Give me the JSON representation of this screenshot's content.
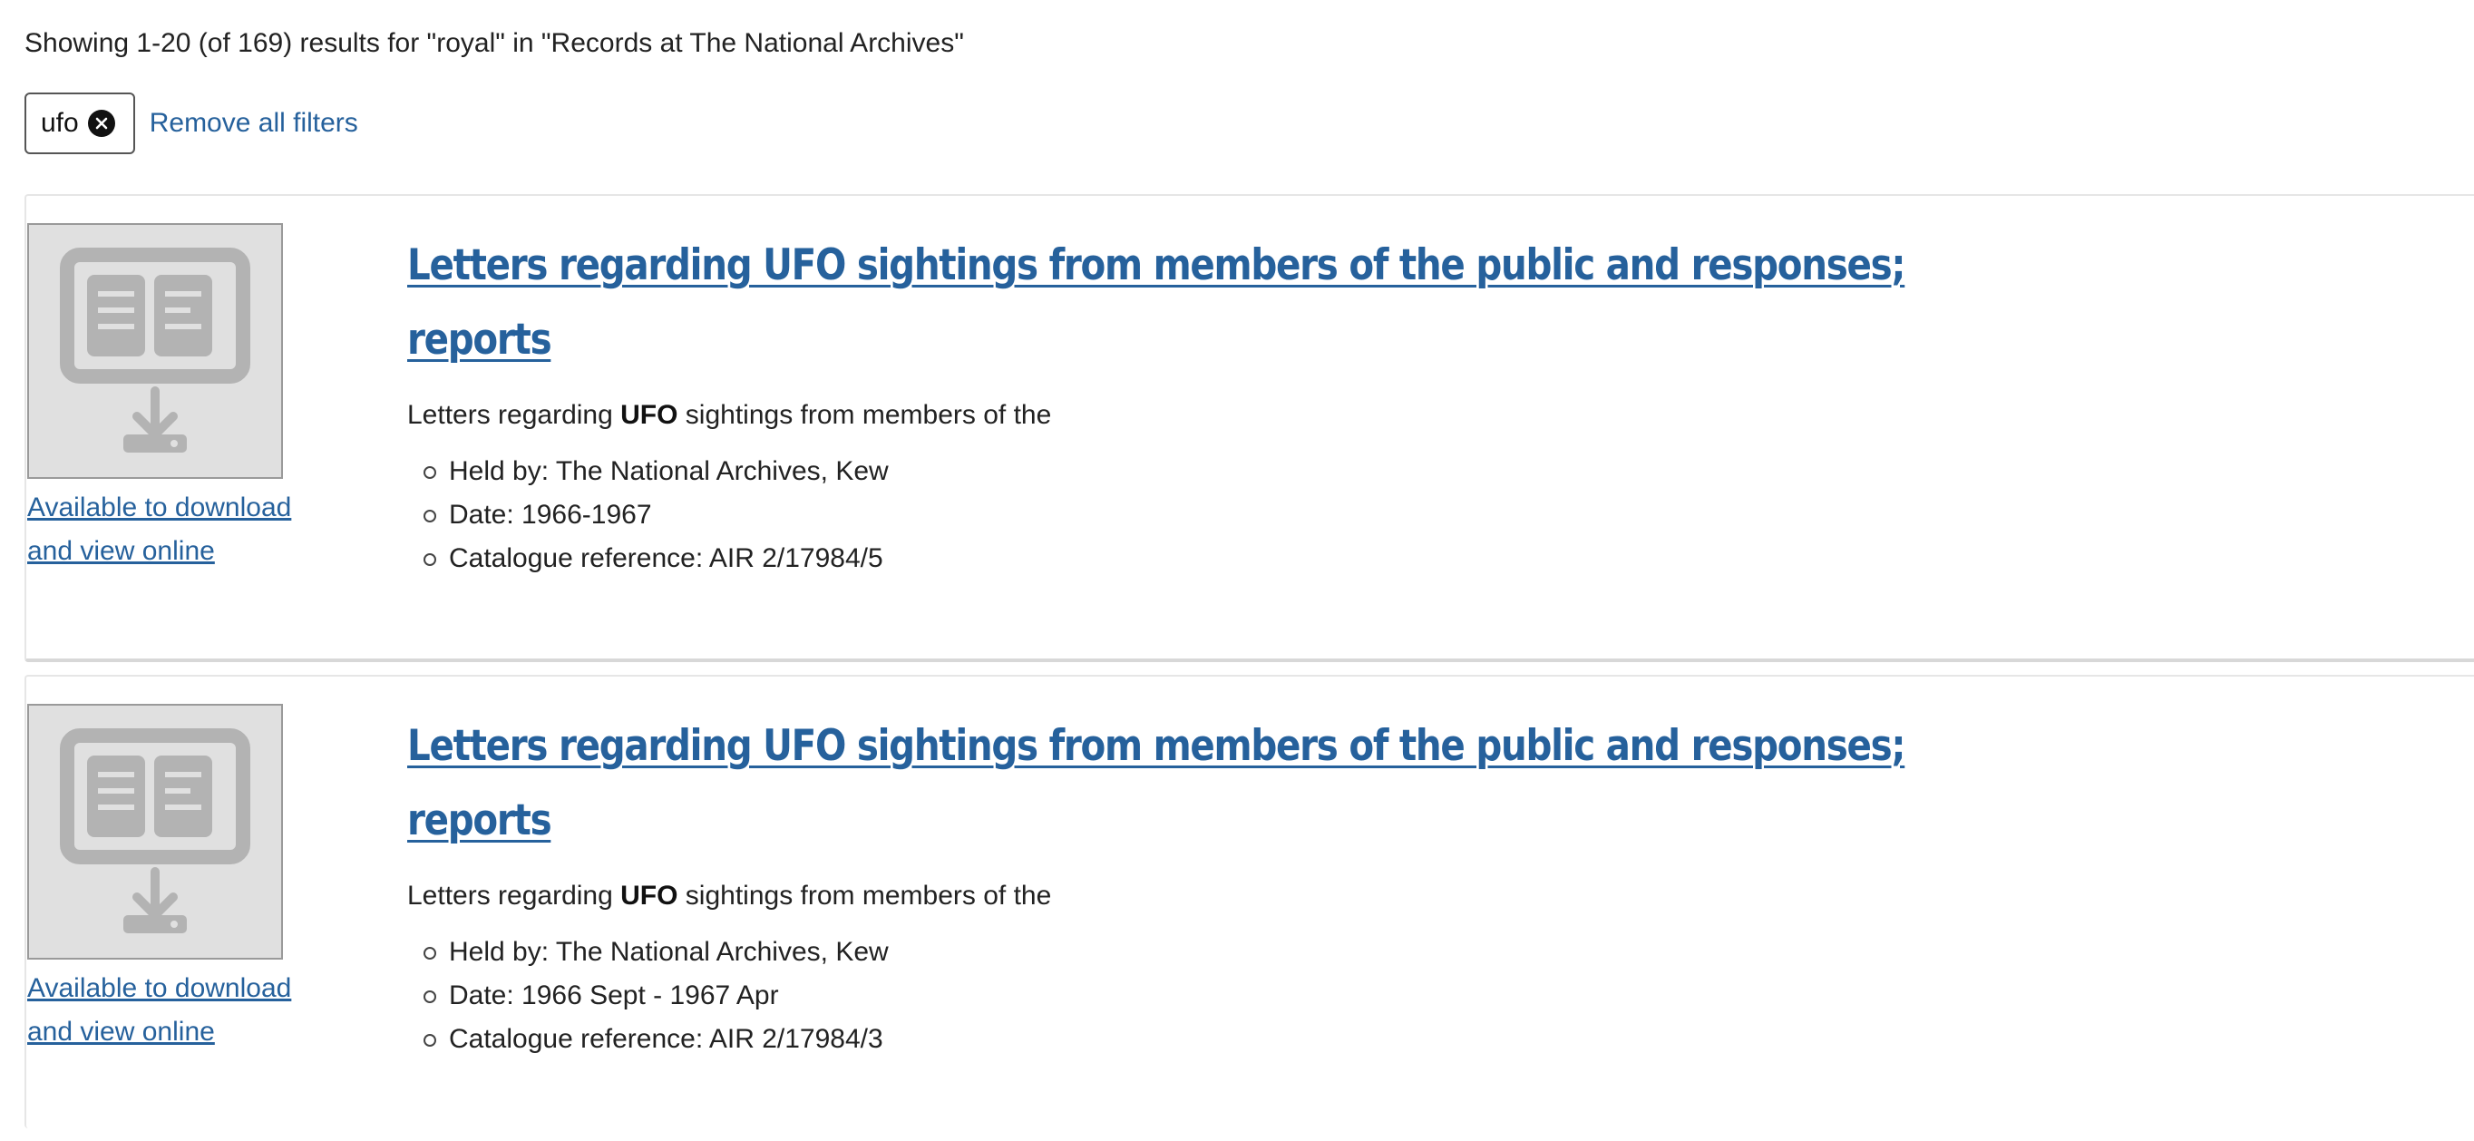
{
  "summary": {
    "text": "Showing 1-20 (of 169) results for \"royal\" in \"Records at The National Archives\""
  },
  "filters": {
    "active": [
      {
        "label": "ufo",
        "remove_icon": "close-circle-icon"
      }
    ],
    "remove_all_label": "Remove all filters"
  },
  "results": [
    {
      "title": "Letters regarding UFO sightings from members of the public and responses; reports",
      "snippet_before": "Letters regarding ",
      "snippet_highlight": "UFO",
      "snippet_after": " sightings from members of the",
      "thumbnail_icon": "digital-download-icon",
      "availability_label": "Available to download and view online",
      "held_by": "Held by: The National Archives, Kew",
      "date": "Date: 1966-1967",
      "reference": "Catalogue reference: AIR 2/17984/5"
    },
    {
      "title": "Letters regarding UFO sightings from members of the public and responses; reports",
      "snippet_before": "Letters regarding ",
      "snippet_highlight": "UFO",
      "snippet_after": " sightings from members of the",
      "thumbnail_icon": "digital-download-icon",
      "availability_label": "Available to download and view online",
      "held_by": "Held by: The National Archives, Kew",
      "date": "Date: 1966 Sept - 1967 Apr",
      "reference": "Catalogue reference: AIR 2/17984/3"
    }
  ],
  "colors": {
    "link": "#26619c",
    "text": "#222222",
    "thumbnail_bg": "#e0e0e0",
    "thumbnail_icon": "#b3b3b3"
  }
}
